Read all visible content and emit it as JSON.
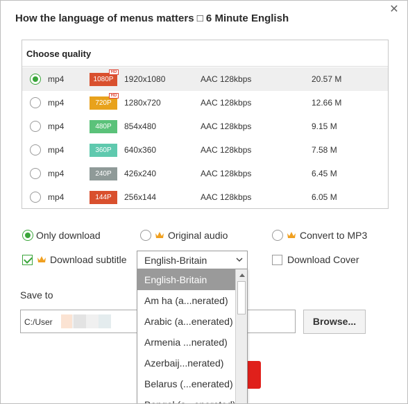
{
  "dialog": {
    "title": "How the language of menus matters □ 6 Minute English",
    "close_glyph": "✕"
  },
  "quality": {
    "header": "Choose quality",
    "rows": [
      {
        "format": "mp4",
        "badge": "1080P",
        "badge_color": "#d9502e",
        "hd": true,
        "resolution": "1920x1080",
        "audio": "AAC 128kbps",
        "size": "20.57 M",
        "selected": true
      },
      {
        "format": "mp4",
        "badge": "720P",
        "badge_color": "#e8a21c",
        "hd": true,
        "resolution": "1280x720",
        "audio": "AAC 128kbps",
        "size": "12.66 M",
        "selected": false
      },
      {
        "format": "mp4",
        "badge": "480P",
        "badge_color": "#5bc27a",
        "hd": false,
        "resolution": "854x480",
        "audio": "AAC 128kbps",
        "size": "9.15 M",
        "selected": false
      },
      {
        "format": "mp4",
        "badge": "360P",
        "badge_color": "#5fc9ae",
        "hd": false,
        "resolution": "640x360",
        "audio": "AAC 128kbps",
        "size": "7.58 M",
        "selected": false
      },
      {
        "format": "mp4",
        "badge": "240P",
        "badge_color": "#8f9a98",
        "hd": false,
        "resolution": "426x240",
        "audio": "AAC 128kbps",
        "size": "6.45 M",
        "selected": false
      },
      {
        "format": "mp4",
        "badge": "144P",
        "badge_color": "#d9502e",
        "hd": false,
        "resolution": "256x144",
        "audio": "AAC 128kbps",
        "size": "6.05 M",
        "selected": false
      }
    ],
    "hd_label": "HD"
  },
  "options": {
    "only_download": "Only download",
    "original_audio": "Original audio",
    "convert_mp3": "Convert to MP3",
    "download_subtitle": "Download subtitle",
    "download_cover": "Download Cover",
    "crown_color": "#f0a020"
  },
  "subtitle_select": {
    "value": "English-Britain",
    "chevron": "⌄",
    "options": [
      "English-Britain",
      "Am ha (a...nerated)",
      "Arabic (a...enerated)",
      "Armenia ...nerated)",
      "Azerbaij...nerated)",
      "Belarus (...enerated)",
      "Bengal (a...enerated)"
    ]
  },
  "save": {
    "label": "Save to",
    "path": "C:/User",
    "browse": "Browse..."
  },
  "colors": {
    "accent_green": "#3aa53a",
    "download_red": "#e0201b"
  }
}
